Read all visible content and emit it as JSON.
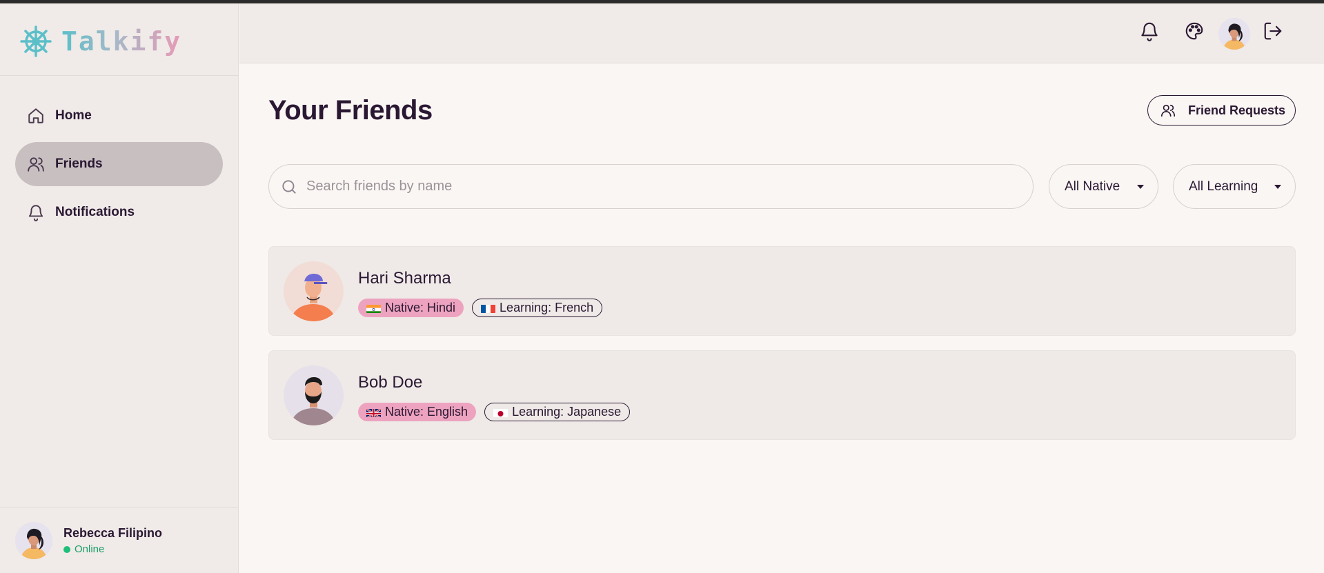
{
  "app": {
    "name": "Talkify"
  },
  "nav": [
    {
      "label": "Home",
      "icon": "home-icon"
    },
    {
      "label": "Friends",
      "icon": "users-icon",
      "active": true
    },
    {
      "label": "Notifications",
      "icon": "bell-icon"
    }
  ],
  "current_user": {
    "name": "Rebecca Filipino",
    "status": "Online"
  },
  "header": {
    "icons": [
      "bell-icon",
      "palette-icon",
      "avatar",
      "logout-icon"
    ]
  },
  "page": {
    "title": "Your Friends",
    "friend_requests_label": "Friend Requests",
    "search_placeholder": "Search friends by name",
    "filter_native": "All Native",
    "filter_learning": "All Learning"
  },
  "friends": [
    {
      "name": "Hari Sharma",
      "native": "Native: Hindi",
      "learning": "Learning: French",
      "native_flag": "india",
      "learning_flag": "france"
    },
    {
      "name": "Bob Doe",
      "native": "Native: English",
      "learning": "Learning: Japanese",
      "native_flag": "uk",
      "learning_flag": "japan"
    }
  ],
  "colors": {
    "accent_pink": "#eda3bf",
    "active_nav": "#c8bfc0",
    "online": "#1fbf7a",
    "logo_teal": "#5bbfc9"
  }
}
